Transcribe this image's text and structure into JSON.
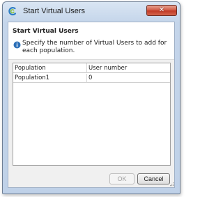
{
  "window": {
    "title": "Start Virtual Users",
    "close_glyph": "✕",
    "accent_color": "#c23a26"
  },
  "header": {
    "title": "Start Virtual Users",
    "description": "Specify the number of Virtual Users to add for each population.",
    "icon": "info-icon"
  },
  "table": {
    "columns": [
      "Population",
      "User number"
    ],
    "rows": [
      {
        "population": "Population1",
        "user_number": "0"
      }
    ]
  },
  "buttons": {
    "ok_label": "OK",
    "ok_enabled": false,
    "cancel_label": "Cancel"
  }
}
